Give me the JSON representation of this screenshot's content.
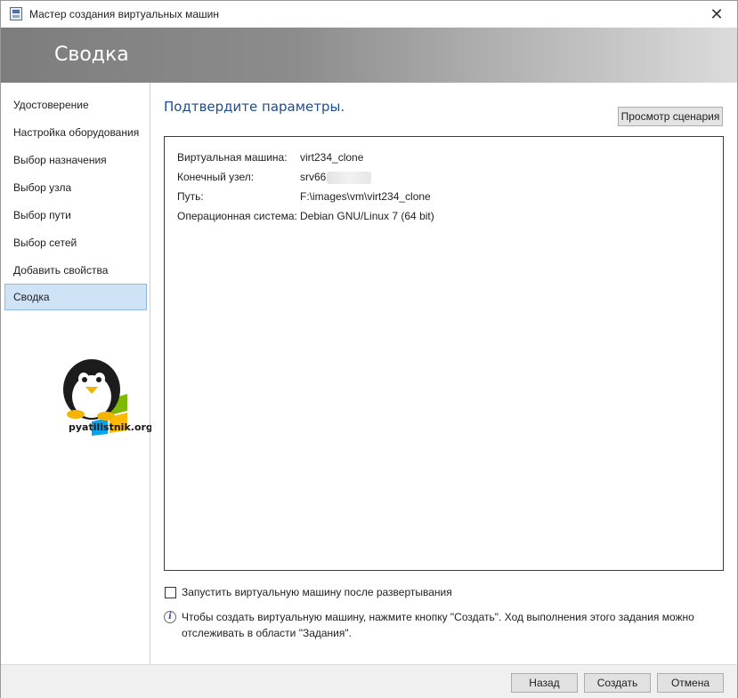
{
  "window": {
    "title": "Мастер создания виртуальных машин",
    "close_glyph": "✕"
  },
  "banner": {
    "title": "Сводка"
  },
  "sidebar": {
    "items": [
      {
        "label": "Удостоверение",
        "active": false
      },
      {
        "label": "Настройка оборудования",
        "active": false
      },
      {
        "label": "Выбор назначения",
        "active": false
      },
      {
        "label": "Выбор узла",
        "active": false
      },
      {
        "label": "Выбор пути",
        "active": false
      },
      {
        "label": "Выбор сетей",
        "active": false
      },
      {
        "label": "Добавить свойства",
        "active": false
      },
      {
        "label": "Сводка",
        "active": true
      }
    ],
    "logo_text": "pyatilistnik.org"
  },
  "main": {
    "title": "Подтвердите параметры.",
    "script_button": "Просмотр сценария",
    "summary": [
      {
        "label": "Виртуальная машина:",
        "value": "virt234_clone"
      },
      {
        "label": "Конечный узел:",
        "value": "srv66"
      },
      {
        "label": "Путь:",
        "value": "F:\\images\\vm\\virt234_clone"
      },
      {
        "label": "Операционная система:",
        "value": "Debian GNU/Linux 7 (64 bit)"
      }
    ],
    "start_vm_checkbox": {
      "label": "Запустить виртуальную машину после развертывания",
      "checked": false
    },
    "info": "Чтобы создать виртуальную машину, нажмите кнопку \"Создать\". Ход выполнения этого задания можно отслеживать в области \"Задания\"."
  },
  "footer": {
    "back": "Назад",
    "create": "Создать",
    "cancel": "Отмена"
  },
  "colors": {
    "accent_title": "#1f4e8c",
    "active_nav": "#cfe3f7",
    "banner_dark": "#7d7d7d"
  }
}
